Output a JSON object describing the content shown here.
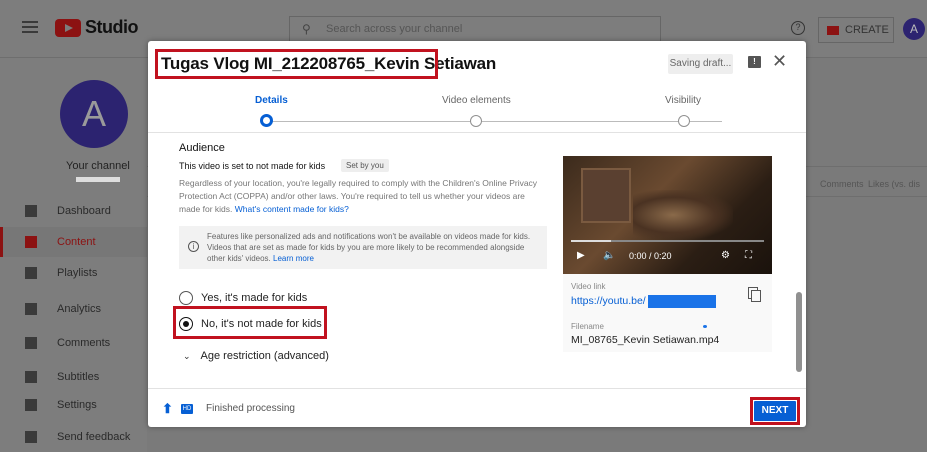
{
  "app": {
    "logo_text": "Studio",
    "search_placeholder": "Search across your channel",
    "create_label": "CREATE",
    "avatar_letter": "A"
  },
  "sidebar": {
    "avatar_letter": "A",
    "channel_label": "Your channel",
    "items": [
      {
        "label": "Dashboard",
        "icon": "dashboard-icon"
      },
      {
        "label": "Content",
        "icon": "content-icon",
        "active": true
      },
      {
        "label": "Playlists",
        "icon": "playlists-icon"
      },
      {
        "label": "Analytics",
        "icon": "analytics-icon"
      },
      {
        "label": "Comments",
        "icon": "comments-icon"
      },
      {
        "label": "Subtitles",
        "icon": "subtitles-icon"
      },
      {
        "label": "Settings",
        "icon": "gear-icon"
      },
      {
        "label": "Send feedback",
        "icon": "feedback-icon"
      }
    ]
  },
  "background_table": {
    "col_comments": "Comments",
    "col_likes": "Likes (vs. dis"
  },
  "modal": {
    "title": "Tugas Vlog MI_212208765_Kevin Setiawan",
    "saving_status": "Saving draft...",
    "steps": [
      {
        "label": "Details",
        "active": true
      },
      {
        "label": "Video elements",
        "active": false
      },
      {
        "label": "Visibility",
        "active": false
      }
    ],
    "audience": {
      "heading": "Audience",
      "set_status": "This video is set to not made for kids",
      "set_by_chip": "Set by you",
      "description": "Regardless of your location, you're legally required to comply with the Children's Online Privacy Protection Act (COPPA) and/or other laws. You're required to tell us whether your videos are made for kids.",
      "description_link": "What's content made for kids?",
      "info_text": "Features like personalized ads and notifications won't be available on videos made for kids. Videos that are set as made for kids by you are more likely to be recommended alongside other kids' videos.",
      "info_link": "Learn more",
      "option_yes": "Yes, it's made for kids",
      "option_no": "No, it's not made for kids",
      "selected": "no",
      "age_restriction": "Age restriction (advanced)"
    },
    "video": {
      "time": "0:00 / 0:20",
      "link_label": "Video link",
      "link_text": "https://youtu.be/",
      "filename_label": "Filename",
      "filename": "MI_08765_Kevin Setiawan.mp4"
    },
    "footer": {
      "status": "Finished processing",
      "next_label": "NEXT"
    }
  },
  "colors": {
    "accent_blue": "#065fd4",
    "highlight_red": "#c1121f",
    "brand_red": "#8c1212"
  }
}
